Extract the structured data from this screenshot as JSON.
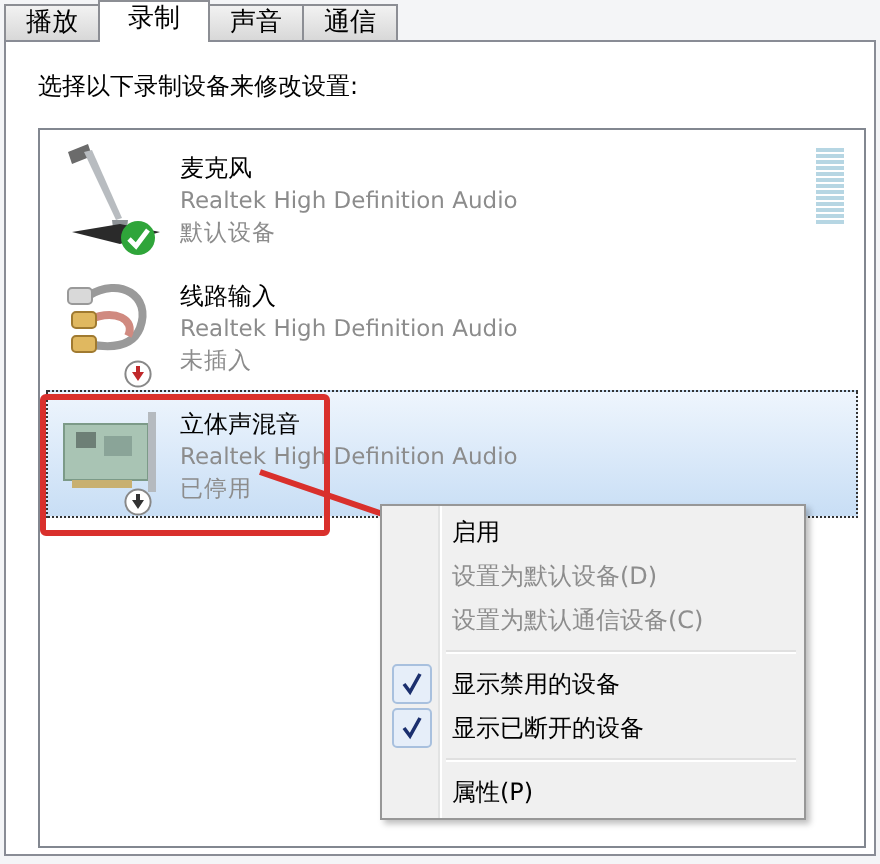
{
  "tabs": [
    {
      "label": "播放",
      "selected": false
    },
    {
      "label": "录制",
      "selected": true
    },
    {
      "label": "声音",
      "selected": false
    },
    {
      "label": "通信",
      "selected": false
    }
  ],
  "instruction": "选择以下录制设备来修改设置:",
  "devices": [
    {
      "name": "麦克风",
      "driver": "Realtek High Definition Audio",
      "status": "默认设备",
      "kind": "microphone",
      "badge": {
        "kind": "default"
      },
      "selected": false,
      "meter": true
    },
    {
      "name": "线路输入",
      "driver": "Realtek High Definition Audio",
      "status": "未插入",
      "kind": "line-in",
      "badge": {
        "kind": "unplugged"
      },
      "selected": false,
      "meter": false
    },
    {
      "name": "立体声混音",
      "driver": "Realtek High Definition Audio",
      "status": "已停用",
      "kind": "card",
      "badge": {
        "kind": "disabled"
      },
      "selected": true,
      "meter": false
    }
  ],
  "context_menu": {
    "items": [
      {
        "kind": "item",
        "label": "启用",
        "disabled": false,
        "checked": false
      },
      {
        "kind": "item",
        "label": "设置为默认设备(D)",
        "disabled": true,
        "checked": false
      },
      {
        "kind": "item",
        "label": "设置为默认通信设备(C)",
        "disabled": true,
        "checked": false
      },
      {
        "kind": "separator"
      },
      {
        "kind": "item",
        "label": "显示禁用的设备",
        "disabled": false,
        "checked": true
      },
      {
        "kind": "item",
        "label": "显示已断开的设备",
        "disabled": false,
        "checked": true
      },
      {
        "kind": "separator"
      },
      {
        "kind": "item",
        "label": "属性(P)",
        "disabled": false,
        "checked": false
      }
    ]
  }
}
